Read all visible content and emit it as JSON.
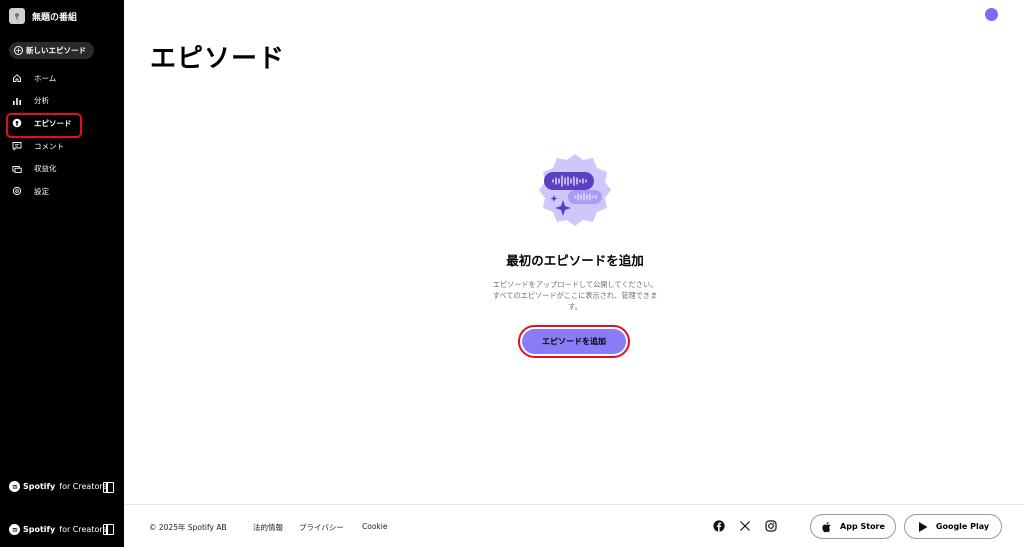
{
  "sidebar": {
    "show_title": "無題の番組",
    "new_episode_label": "新しいエピソード",
    "items": [
      {
        "label": "ホーム",
        "icon": "home-icon"
      },
      {
        "label": "分析",
        "icon": "analytics-icon"
      },
      {
        "label": "エピソード",
        "icon": "episode-icon",
        "active": true
      },
      {
        "label": "コメント",
        "icon": "comment-icon"
      },
      {
        "label": "収益化",
        "icon": "monetize-icon"
      },
      {
        "label": "設定",
        "icon": "settings-icon"
      }
    ],
    "brand_name": "Spotify",
    "brand_suffix": "for Creators"
  },
  "main": {
    "title": "エピソード",
    "empty_title": "最初のエピソードを追加",
    "empty_desc_line1": "エピソードをアップロードして公開してください。",
    "empty_desc_line2": "すべてのエピソードがここに表示され、管理できま",
    "empty_desc_line3": "す。",
    "add_button_label": "エピソードを追加"
  },
  "footer": {
    "copyright": "© 2025年 Spotify AB",
    "links": [
      "法的情報",
      "プライバシー",
      "Cookie"
    ],
    "app_store_label": "App Store",
    "google_play_label": "Google Play"
  },
  "colors": {
    "accent": "#8b7cf6",
    "avatar": "#7b6cf2",
    "highlight": "#e0101d",
    "sidebar_bg": "#000000"
  }
}
